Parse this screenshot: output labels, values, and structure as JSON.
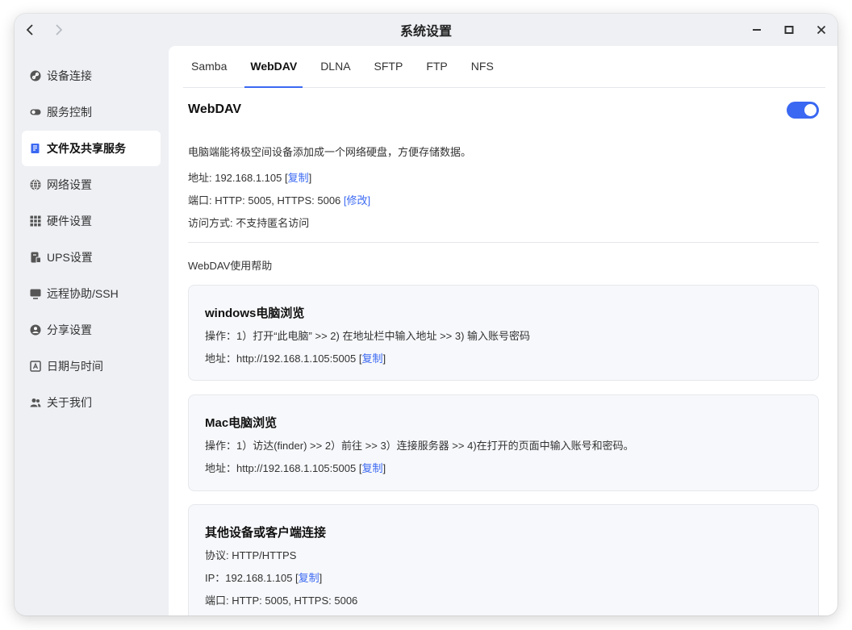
{
  "window": {
    "title": "系统设置"
  },
  "sidebar": {
    "items": [
      {
        "label": "设备连接",
        "icon": "link-icon"
      },
      {
        "label": "服务控制",
        "icon": "toggle-icon"
      },
      {
        "label": "文件及共享服务",
        "icon": "file-share-icon"
      },
      {
        "label": "网络设置",
        "icon": "globe-icon"
      },
      {
        "label": "硬件设置",
        "icon": "grid-icon"
      },
      {
        "label": "UPS设置",
        "icon": "battery-icon"
      },
      {
        "label": "远程协助/SSH",
        "icon": "monitor-icon"
      },
      {
        "label": "分享设置",
        "icon": "share-icon"
      },
      {
        "label": "日期与时间",
        "icon": "calendar-icon"
      },
      {
        "label": "关于我们",
        "icon": "users-icon"
      }
    ],
    "active_index": 2
  },
  "tabs": [
    {
      "label": "Samba"
    },
    {
      "label": "WebDAV"
    },
    {
      "label": "DLNA"
    },
    {
      "label": "SFTP"
    },
    {
      "label": "FTP"
    },
    {
      "label": "NFS"
    }
  ],
  "active_tab": "WebDAV",
  "webdav": {
    "title": "WebDAV",
    "enabled": true,
    "description": "电脑端能将极空间设备添加成一个网络硬盘，方便存储数据。",
    "address_label": "地址: 192.168.1.105 ",
    "copy_label": "复制",
    "port_label": "端口: HTTP: 5005, HTTPS: 5006 ",
    "modify_label": "修改",
    "access_label": "访问方式: 不支持匿名访问"
  },
  "help": {
    "title": "WebDAV使用帮助",
    "cards": [
      {
        "title": "windows电脑浏览",
        "lines": [
          "操作：1）打开“此电脑” >> 2) 在地址栏中输入地址 >> 3) 输入账号密码",
          "地址：http://192.168.1.105:5005 "
        ],
        "copy_label": "复制"
      },
      {
        "title": "Mac电脑浏览",
        "lines": [
          "操作：1）访达(finder) >> 2）前往 >> 3）连接服务器 >> 4)在打开的页面中输入账号和密码。",
          "地址：http://192.168.1.105:5005 "
        ],
        "copy_label": "复制"
      },
      {
        "title": "其他设备或客户端连接",
        "lines": [
          "协议: HTTP/HTTPS",
          "IP：192.168.1.105 ",
          "端口: HTTP: 5005, HTTPS: 5006"
        ],
        "copy_label": "复制"
      }
    ]
  },
  "colors": {
    "accent": "#3a68f2",
    "sidebar_bg": "#eef0f4",
    "card_bg": "#f7f8fb"
  }
}
